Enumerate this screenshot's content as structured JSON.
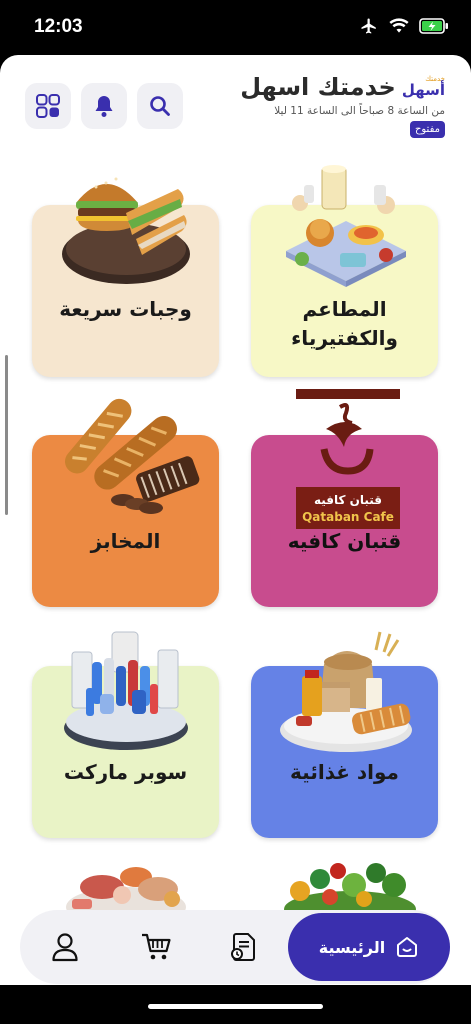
{
  "status_bar": {
    "time": "12:03"
  },
  "header": {
    "logo_top": "خدمتك",
    "logo_main": "أسهل",
    "title": "خدمتك اسهل",
    "hours": "من الساعة 8 صباحاً الى الساعة 11 ليلا",
    "status": "مفتوح",
    "icons": [
      "grid-icon",
      "bell-icon",
      "search-icon"
    ]
  },
  "categories": [
    {
      "label": "المطاعم والكفتيرياء",
      "bg": "#f7f8c6"
    },
    {
      "label": "وجبات سريعة",
      "bg": "#f6e6cf"
    },
    {
      "label": "قتبان كافيه",
      "bg": "#c84c8e",
      "logo_ar": "قتبان كافيه",
      "logo_en": "Qataban Cafe"
    },
    {
      "label": "المخابز",
      "bg": "#ec8a43"
    },
    {
      "label": "مواد غذائية",
      "bg": "#6582e6"
    },
    {
      "label": "سوبر ماركت",
      "bg": "#e9f3c6"
    }
  ],
  "bottom_nav": {
    "home_label": "الرئيسية",
    "accent": "#3a2fae",
    "icons": [
      "home-icon",
      "orders-icon",
      "cart-icon",
      "profile-icon"
    ]
  }
}
